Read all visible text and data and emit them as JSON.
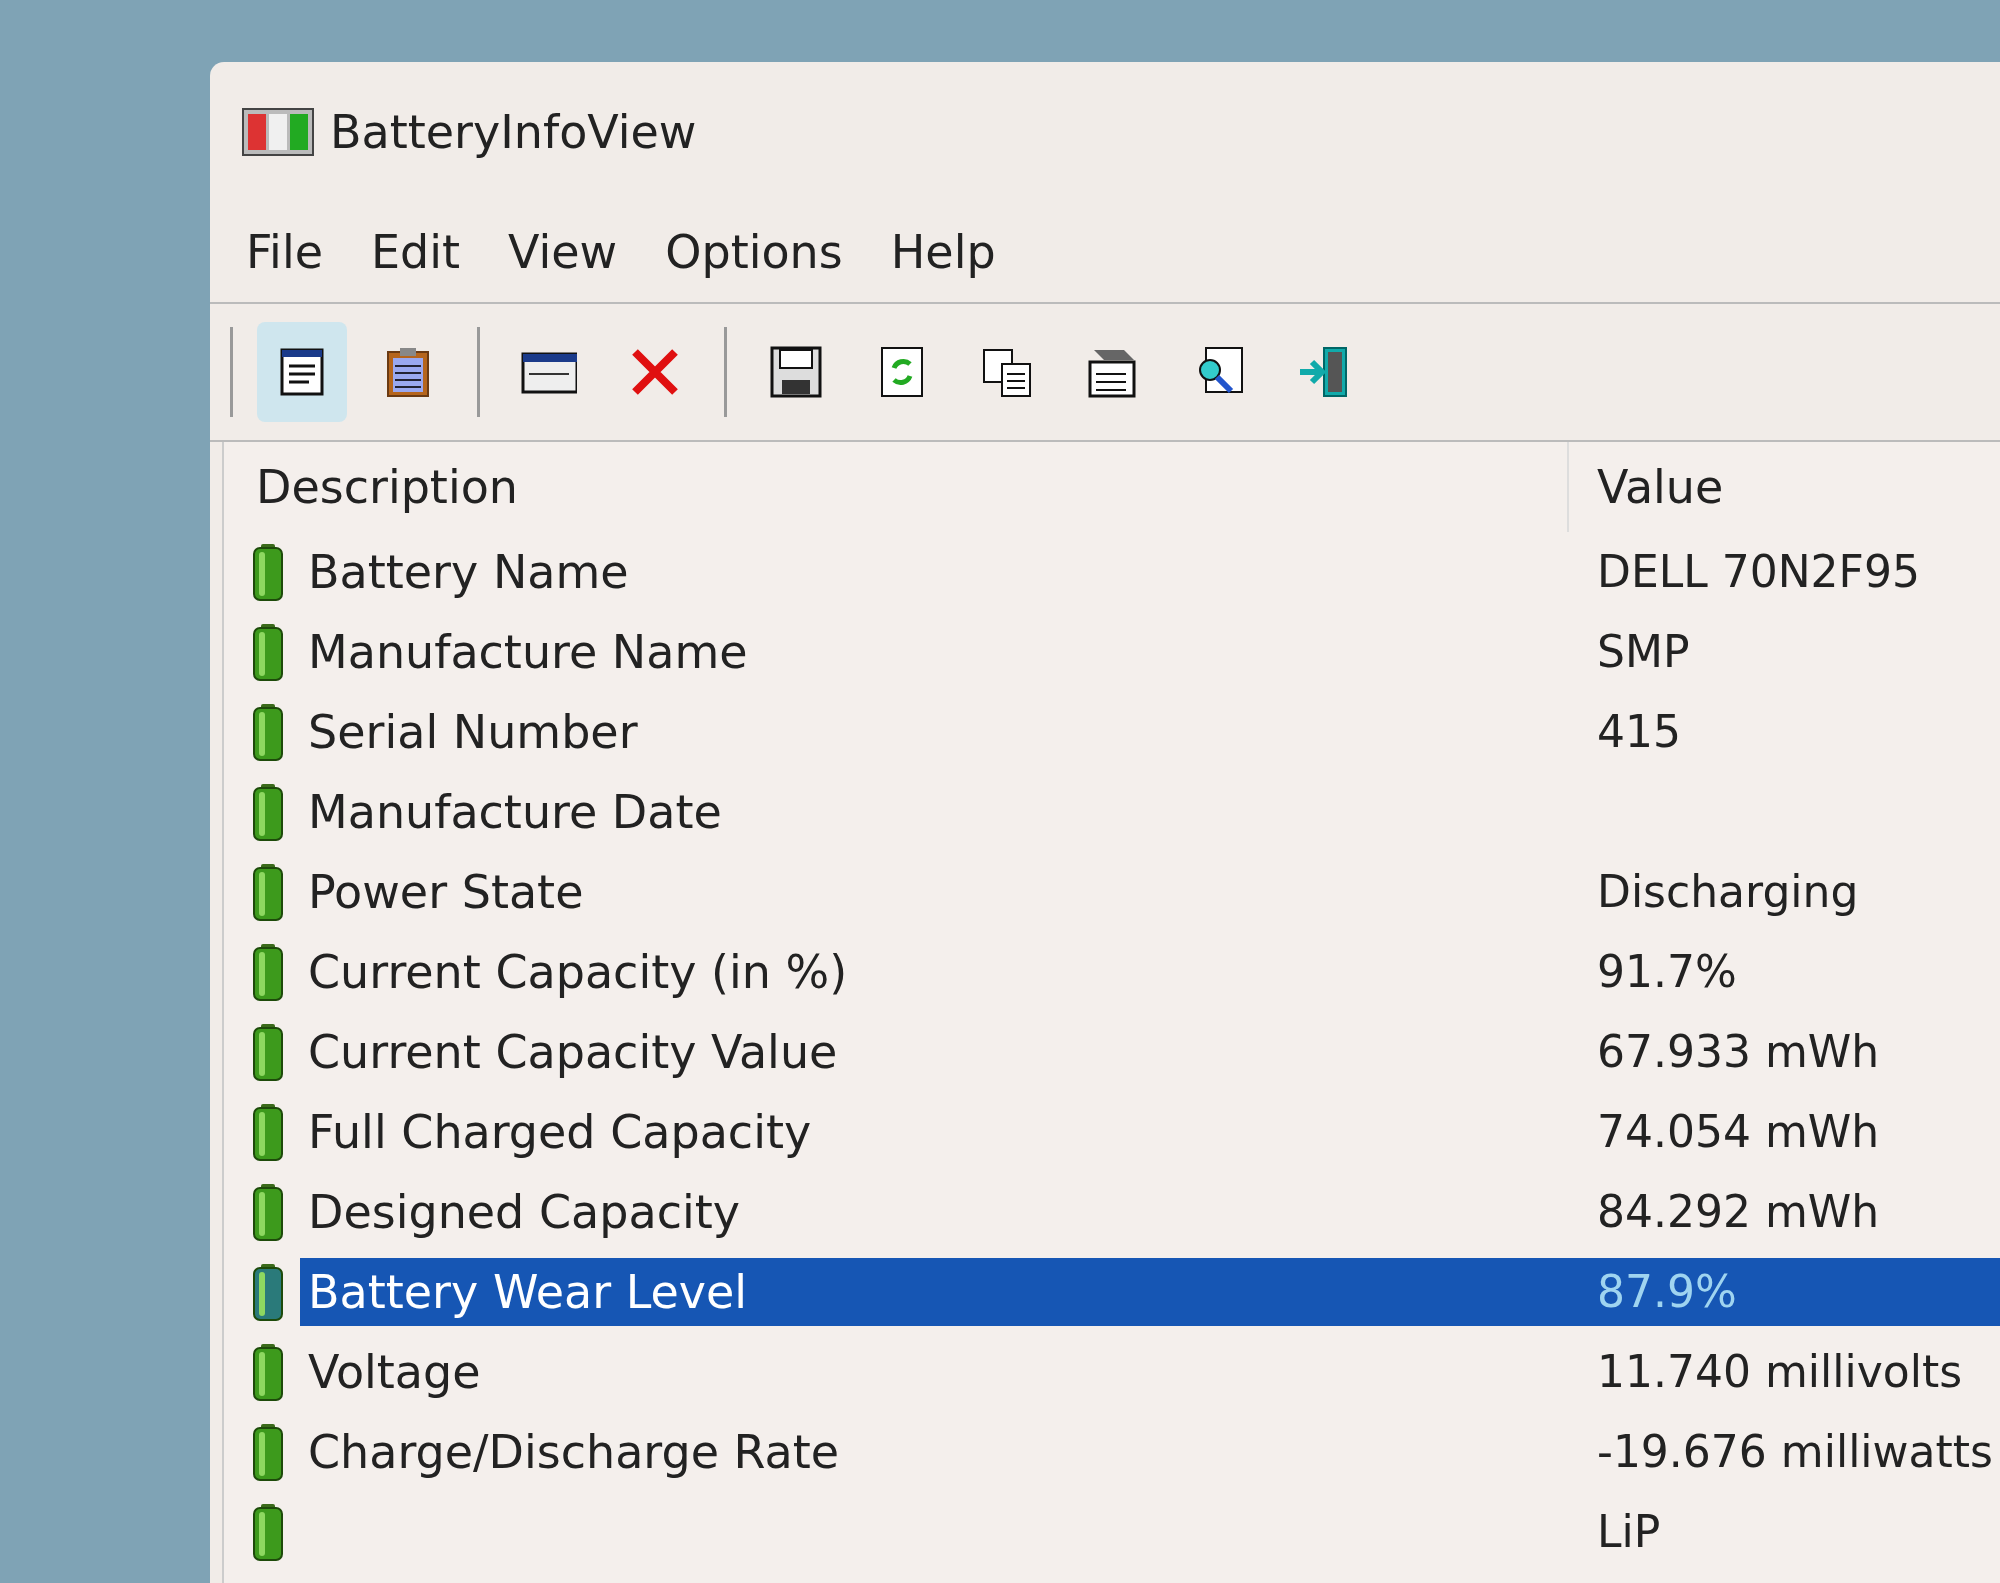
{
  "window": {
    "title": "BatteryInfoView"
  },
  "menu": [
    "File",
    "Edit",
    "View",
    "Options",
    "Help"
  ],
  "toolbar": [
    {
      "kind": "separator"
    },
    {
      "kind": "document",
      "pressed": true
    },
    {
      "kind": "clipboard",
      "pressed": false
    },
    {
      "kind": "separator"
    },
    {
      "kind": "window",
      "pressed": false
    },
    {
      "kind": "delete",
      "pressed": false
    },
    {
      "kind": "separator"
    },
    {
      "kind": "save",
      "pressed": false
    },
    {
      "kind": "refresh",
      "pressed": false
    },
    {
      "kind": "copy",
      "pressed": false
    },
    {
      "kind": "properties",
      "pressed": false
    },
    {
      "kind": "find",
      "pressed": false
    },
    {
      "kind": "exit",
      "pressed": false
    }
  ],
  "table": {
    "columns": [
      "Description",
      "Value"
    ],
    "rows": [
      {
        "description": "Battery Name",
        "value": "DELL 70N2F95",
        "selected": false
      },
      {
        "description": "Manufacture Name",
        "value": "SMP",
        "selected": false
      },
      {
        "description": "Serial Number",
        "value": "415",
        "selected": false
      },
      {
        "description": "Manufacture Date",
        "value": "",
        "selected": false
      },
      {
        "description": "Power State",
        "value": "Discharging",
        "selected": false
      },
      {
        "description": "Current Capacity (in %)",
        "value": "91.7%",
        "selected": false
      },
      {
        "description": "Current Capacity Value",
        "value": "67.933 mWh",
        "selected": false
      },
      {
        "description": "Full Charged Capacity",
        "value": "74.054 mWh",
        "selected": false
      },
      {
        "description": "Designed Capacity",
        "value": "84.292 mWh",
        "selected": false
      },
      {
        "description": "Battery Wear Level",
        "value": "87.9%",
        "selected": true
      },
      {
        "description": "Voltage",
        "value": "11.740 millivolts",
        "selected": false
      },
      {
        "description": "Charge/Discharge Rate",
        "value": "-19.676 milliwatts",
        "selected": false
      },
      {
        "description": "",
        "value": "LiP",
        "selected": false
      }
    ]
  }
}
